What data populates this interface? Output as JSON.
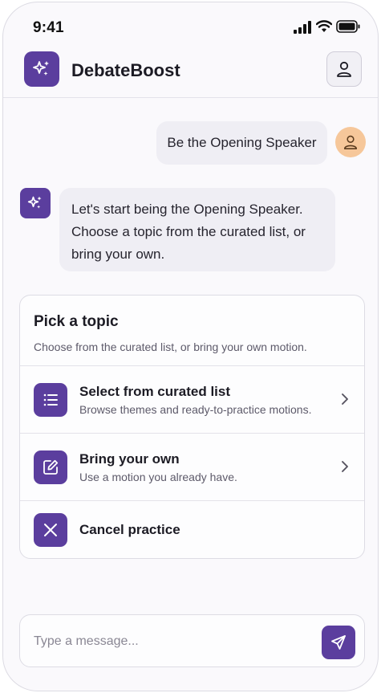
{
  "status_bar": {
    "time": "9:41"
  },
  "header": {
    "app_name": "DebateBoost"
  },
  "chat": {
    "user_message": "Be the Opening Speaker",
    "assistant_lines": [
      "Let's start being the Opening Speaker.",
      "Choose a topic from the curated list, or",
      "bring your own."
    ]
  },
  "topic_card": {
    "title": "Pick a topic",
    "subtitle": "Choose from the curated list, or bring your own motion.",
    "options": [
      {
        "icon": "list-icon",
        "title": "Select from curated list",
        "description": "Browse themes and ready-to-practice motions."
      },
      {
        "icon": "edit-icon",
        "title": "Bring your own",
        "description": "Use a motion you already have."
      },
      {
        "icon": "close-icon",
        "title": "Cancel practice"
      }
    ]
  },
  "composer": {
    "placeholder": "Type a message..."
  },
  "colors": {
    "accent": "#5b3e9e",
    "bubble": "#efeef4",
    "avatar": "#f6c79a"
  }
}
